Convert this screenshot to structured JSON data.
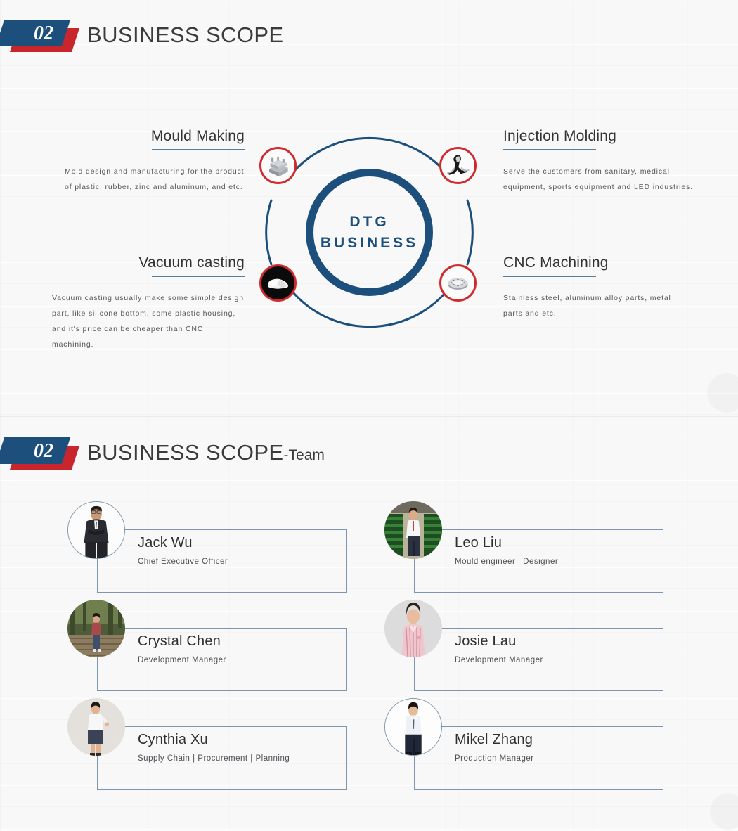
{
  "sections": [
    {
      "badge_number": "02",
      "title": "BUSINESS SCOPE",
      "suffix": ""
    },
    {
      "badge_number": "02",
      "title": "BUSINESS SCOPE",
      "suffix": "-Team"
    }
  ],
  "diagram": {
    "center_line1": "DTG",
    "center_line2": "BUSINESS",
    "accent_blue": "#1d4f7c",
    "accent_red": "#cf2a2e",
    "nodes": [
      {
        "icon": "mould-tool-icon",
        "position": "top-left"
      },
      {
        "icon": "injection-part-icon",
        "position": "top-right"
      },
      {
        "icon": "silicone-part-icon",
        "position": "bottom-left"
      },
      {
        "icon": "cnc-flange-icon",
        "position": "bottom-right"
      }
    ]
  },
  "services": [
    {
      "title": "Mould Making",
      "body": "Mold design and manufacturing for the product of plastic, rubber, zinc and aluminum, and etc."
    },
    {
      "title": "Injection Molding",
      "body": "Serve the customers from sanitary, medical equipment, sports equipment and LED industries."
    },
    {
      "title": "Vacuum casting",
      "body": "Vacuum casting usually make some simple design part, like silicone bottom, some plastic housing, and it's price can be cheaper than CNC machining."
    },
    {
      "title": "CNC Machining",
      "body": "Stainless steel, aluminum alloy parts, metal parts and etc."
    }
  ],
  "team": [
    {
      "name": "Jack Wu",
      "role": "Chief Executive Officer"
    },
    {
      "name": "Leo Liu",
      "role": "Mould engineer | Designer"
    },
    {
      "name": "Crystal Chen",
      "role": "Development Manager"
    },
    {
      "name": "Josie Lau",
      "role": "Development Manager"
    },
    {
      "name": "Cynthia Xu",
      "role": "Supply Chain | Procurement | Planning"
    },
    {
      "name": "Mikel Zhang",
      "role": "Production Manager"
    }
  ]
}
